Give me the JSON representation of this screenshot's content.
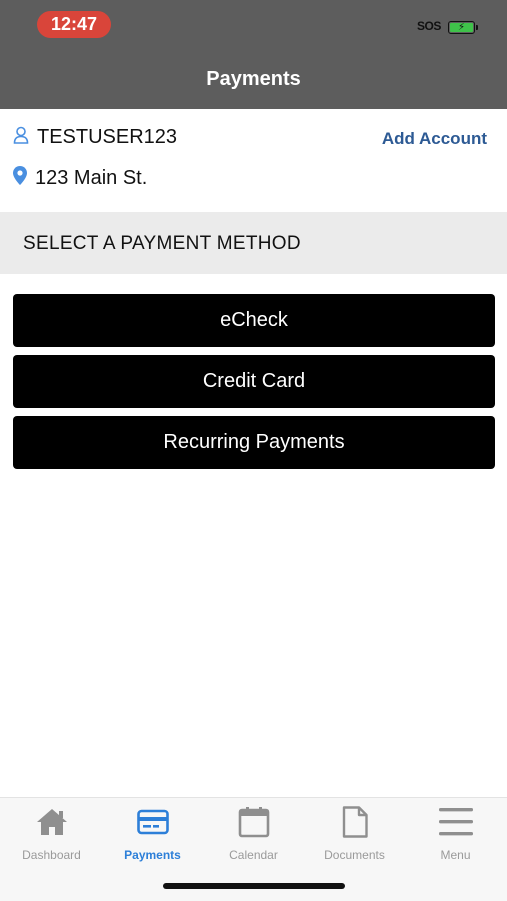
{
  "status_bar": {
    "time": "12:47",
    "sos": "SOS"
  },
  "header": {
    "title": "Payments"
  },
  "account": {
    "username": "TESTUSER123",
    "address": "123 Main St.",
    "add_account_label": "Add Account"
  },
  "section": {
    "title": "SELECT A PAYMENT METHOD"
  },
  "payment_methods": [
    {
      "label": "eCheck"
    },
    {
      "label": "Credit Card"
    },
    {
      "label": "Recurring Payments"
    }
  ],
  "tabs": [
    {
      "label": "Dashboard",
      "icon": "home-icon",
      "active": false
    },
    {
      "label": "Payments",
      "icon": "credit-card-icon",
      "active": true
    },
    {
      "label": "Calendar",
      "icon": "calendar-icon",
      "active": false
    },
    {
      "label": "Documents",
      "icon": "document-icon",
      "active": false
    },
    {
      "label": "Menu",
      "icon": "hamburger-menu-icon",
      "active": false
    }
  ],
  "colors": {
    "header_bg": "#5d5d5d",
    "time_pill": "#d9453a",
    "link": "#2d5a94",
    "tab_active": "#2d7fd8",
    "tab_inactive": "#9a9a9a",
    "button_bg": "#000000"
  }
}
